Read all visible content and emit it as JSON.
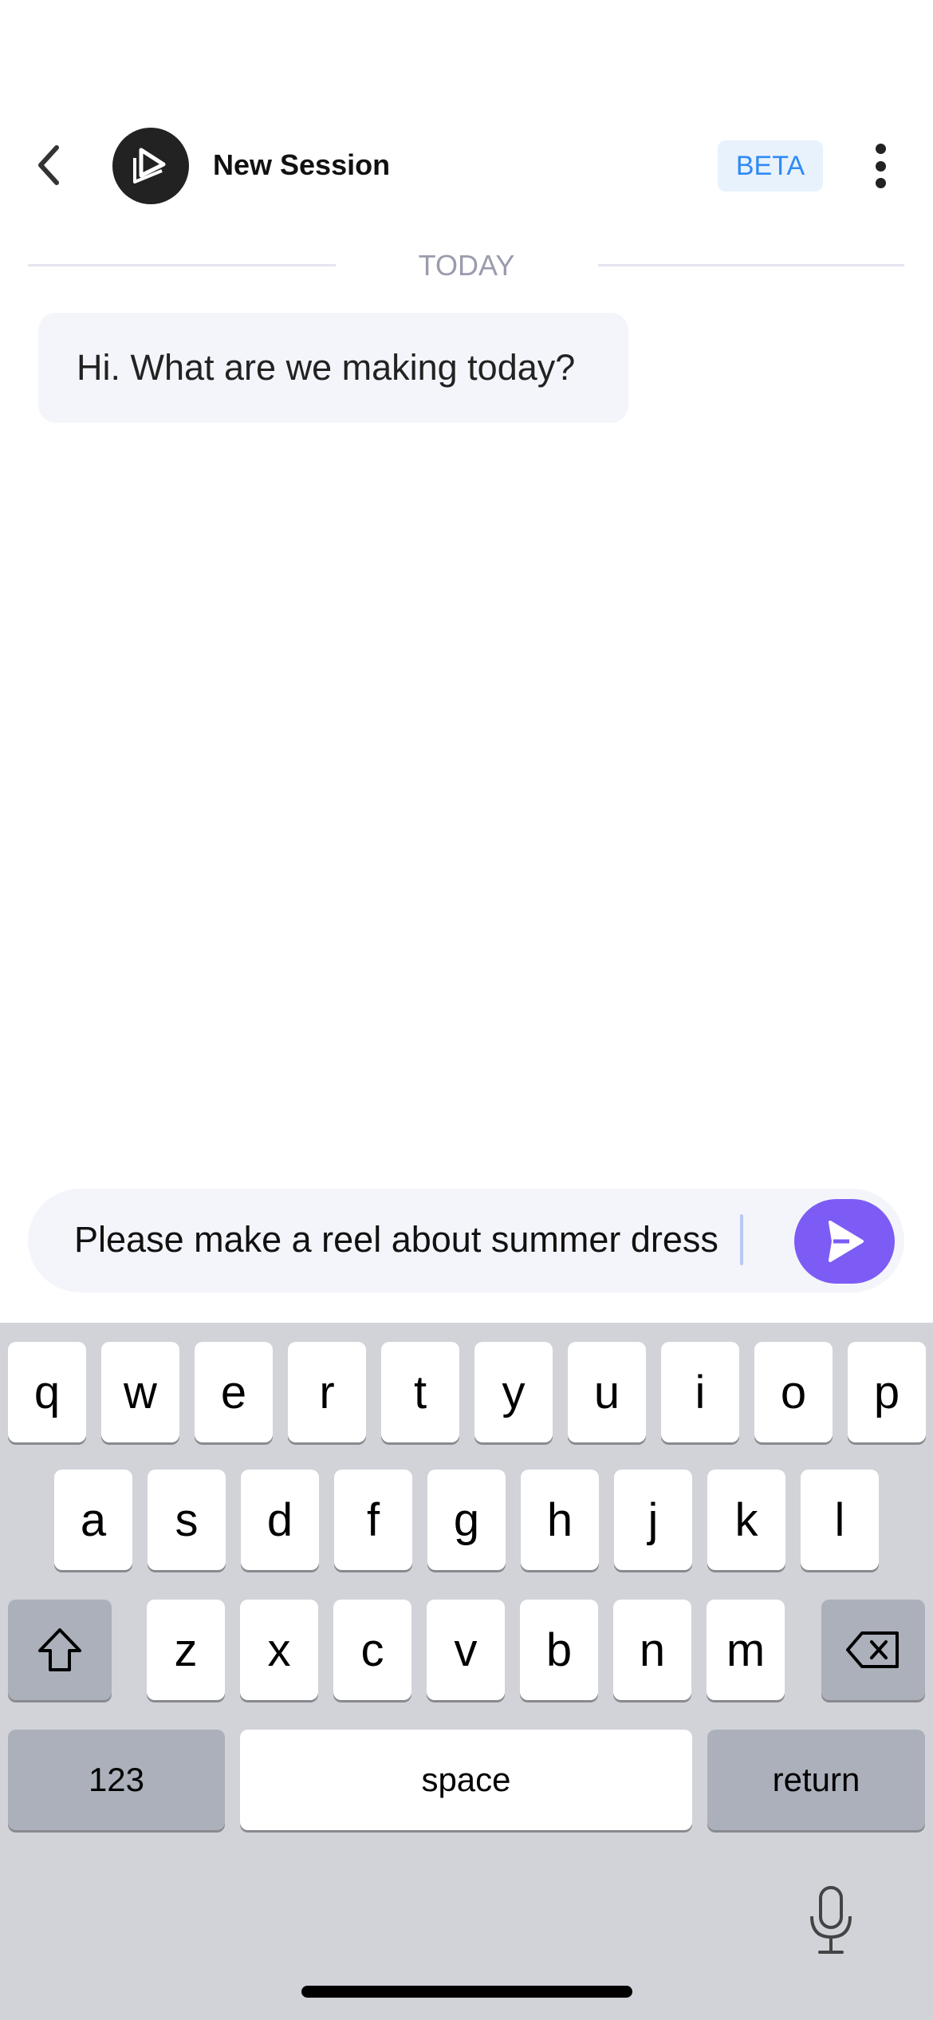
{
  "header": {
    "title": "New Session",
    "badge": "BETA",
    "back_icon": "chevron-left-icon",
    "logo_icon": "app-logo",
    "menu_icon": "more-vertical-icon"
  },
  "chat": {
    "date_divider": "TODAY",
    "messages": [
      {
        "sender": "assistant",
        "text": "Hi. What are we making today?"
      }
    ]
  },
  "composer": {
    "value": "Please make a reel about summer dress",
    "send_icon": "send-icon",
    "send_color": "#7c5cf4"
  },
  "keyboard": {
    "row1": [
      "q",
      "w",
      "e",
      "r",
      "t",
      "y",
      "u",
      "i",
      "o",
      "p"
    ],
    "row2": [
      "a",
      "s",
      "d",
      "f",
      "g",
      "h",
      "j",
      "k",
      "l"
    ],
    "row3": [
      "z",
      "x",
      "c",
      "v",
      "b",
      "n",
      "m"
    ],
    "numbers_label": "123",
    "space_label": "space",
    "return_label": "return",
    "shift_icon": "shift-icon",
    "delete_icon": "backspace-icon",
    "mic_icon": "microphone-icon"
  }
}
